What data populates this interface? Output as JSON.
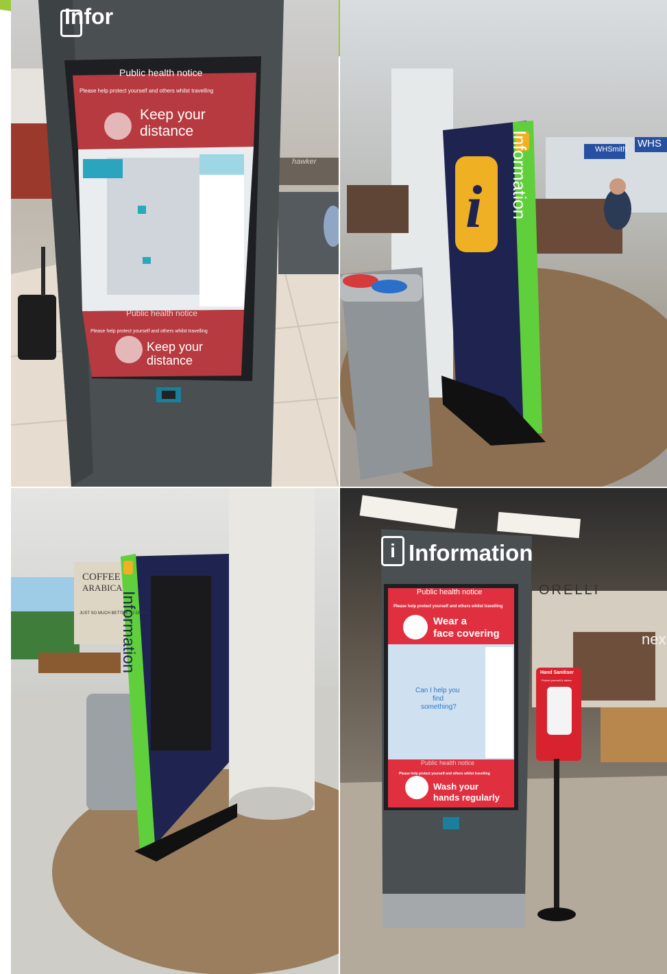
{
  "colors": {
    "banner": "#9dc93b",
    "kiosk_gray": "#4a4f52",
    "kiosk_navy": "#1e2350",
    "info_green": "#5fd03b",
    "info_yellow": "#f0b023",
    "notice_red": "#b63a3f",
    "notice_bright_red": "#e03040",
    "screen_blue": "#cfe0f0"
  },
  "photo1": {
    "header_partial": "Infor",
    "notice_title": "Public health notice",
    "notice_sub": "Please help protect yourself and others whilst travelling",
    "msg_line1": "Keep your",
    "msg_line2": "distance",
    "lower_notice_title": "Public health notice",
    "lower_notice_sub": "Please help protect yourself and others whilst travelling",
    "lower_msg_line1": "Keep your",
    "lower_msg_line2": "distance",
    "background_sign": "hawker"
  },
  "photo2": {
    "side_text": "Information",
    "shop_sign_1": "WHSmith",
    "shop_sign_2": "WHS"
  },
  "photo3": {
    "side_text": "Information",
    "wall_text_1": "COFFEE",
    "wall_text_2": "ARABICA",
    "wall_text_3": "JUST SO MUCH BETTER TO DRINK"
  },
  "photo4": {
    "header": "Information",
    "notice_title": "Public health notice",
    "notice_sub": "Please help protect yourself and others whilst travelling",
    "msg_line1": "Wear a",
    "msg_line2": "face covering",
    "prompt_line1": "Can I help you",
    "prompt_line2": "find",
    "prompt_line3": "something?",
    "lower_notice_title": "Public health notice",
    "lower_notice_sub": "Please help protect yourself and others whilst travelling",
    "lower_msg_line1": "Wash your",
    "lower_msg_line2": "hands regularly",
    "store_sign": "ORELLI",
    "store_sign_2": "nex",
    "sanitiser_title": "Hand Sanitiser",
    "sanitiser_sub": "Protect yourself & others"
  }
}
